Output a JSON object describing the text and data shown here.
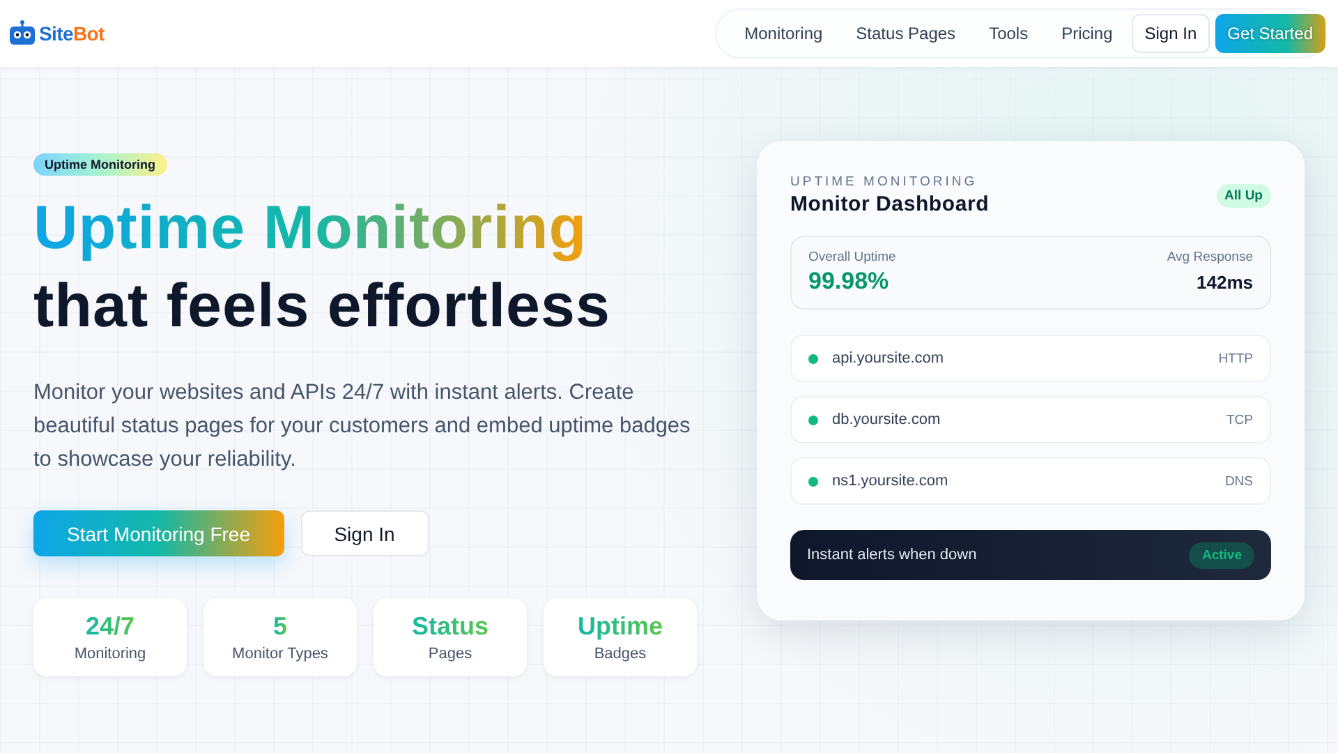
{
  "brand": [
    "Site",
    "Bot"
  ],
  "nav": {
    "links": [
      "Monitoring",
      "Status Pages",
      "Tools",
      "Pricing"
    ],
    "sign_in": "Sign In",
    "cta": "Get Started"
  },
  "hero": {
    "tag": "Uptime Monitoring",
    "headline_accent": "Uptime Monitoring",
    "headline": "that feels effortless",
    "description": "Monitor your websites and APIs 24/7 with instant alerts. Create beautiful status pages for your customers and embed uptime badges to showcase your reliability.",
    "primary_button": "Start Monitoring Free",
    "secondary_button": "Sign In",
    "stats": [
      {
        "value": "24/7",
        "label": "Monitoring"
      },
      {
        "value": "5",
        "label": "Monitor Types"
      },
      {
        "value": "Status",
        "label": "Pages"
      },
      {
        "value": "Uptime",
        "label": "Badges"
      }
    ]
  },
  "dashboard": {
    "eyebrow": "UPTIME MONITORING",
    "title": "Monitor Dashboard",
    "status_badge": "All Up",
    "uptime_label": "Overall Uptime",
    "uptime_value": "99.98%",
    "response_label": "Avg Response",
    "response_value": "142ms",
    "monitors": [
      {
        "host": "api.yoursite.com",
        "type": "HTTP",
        "color": "#10b981"
      },
      {
        "host": "db.yoursite.com",
        "type": "TCP",
        "color": "#10b981"
      },
      {
        "host": "ns1.yoursite.com",
        "type": "DNS",
        "color": "#10b981"
      }
    ],
    "alert": {
      "label": "Instant alerts when down",
      "status": "Active"
    }
  }
}
